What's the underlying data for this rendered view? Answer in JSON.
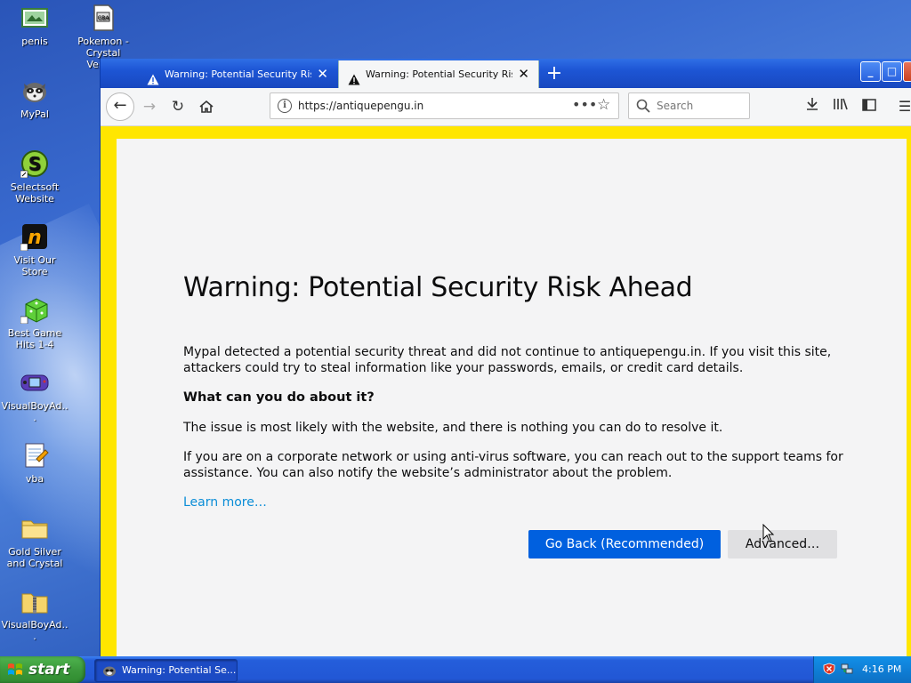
{
  "desktop": {
    "icons": [
      {
        "label": "penis",
        "icon": "image-file-icon"
      },
      {
        "label": "Pokemon - Crystal Versi...",
        "icon": "document-icon"
      },
      {
        "label": "MyPal",
        "icon": "mypal-raccoon-icon"
      },
      {
        "label": "Selectsoft Website",
        "icon": "selectsoft-icon"
      },
      {
        "label": "Visit Our Store",
        "icon": "store-icon"
      },
      {
        "label": "Best Game Hits 1-4",
        "icon": "dice-icon"
      },
      {
        "label": "VisualBoyAd...",
        "icon": "gameboy-icon"
      },
      {
        "label": "vba",
        "icon": "notepad-icon"
      },
      {
        "label": "Gold Silver and Crystal",
        "icon": "folder-icon"
      },
      {
        "label": "VisualBoyAd...",
        "icon": "zip-folder-icon"
      }
    ]
  },
  "browser": {
    "tabs": [
      {
        "title": "Warning: Potential Security Risk Ahead",
        "active": false
      },
      {
        "title": "Warning: Potential Security Risk Ahead",
        "active": true
      }
    ],
    "url": "https://antiquepengu.in",
    "search_placeholder": "Search",
    "page": {
      "heading": "Warning: Potential Security Risk Ahead",
      "intro": "Mypal detected a potential security threat and did not continue to antiquepengu.in. If you visit this site, attackers could try to steal information like your passwords, emails, or credit card details.",
      "subheading": "What can you do about it?",
      "para1": "The issue is most likely with the website, and there is nothing you can do to resolve it.",
      "para2": "If you are on a corporate network or using anti-virus software, you can reach out to the support teams for assistance. You can also notify the website’s administrator about the problem.",
      "learn_more": "Learn more…",
      "go_back_label": "Go Back (Recommended)",
      "advanced_label": "Advanced…"
    },
    "colors": {
      "page_border": "#ffe600",
      "primary_button": "#0060df",
      "link": "#0a8dd7"
    }
  },
  "taskbar": {
    "start_label": "start",
    "task_label": "Warning: Potential Se...",
    "clock": "4:16 PM"
  }
}
